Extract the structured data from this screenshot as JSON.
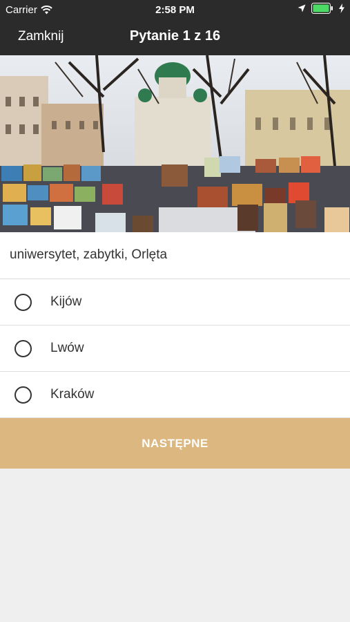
{
  "status_bar": {
    "carrier": "Carrier",
    "time": "2:58 PM",
    "icons": [
      "wifi-icon",
      "location-icon",
      "battery-icon",
      "charging-icon"
    ]
  },
  "nav": {
    "close_label": "Zamknij",
    "title": "Pytanie 1 z 16"
  },
  "question": {
    "hint": "uniwersytet, zabytki, Orlęta"
  },
  "options": [
    {
      "label": "Kijów",
      "selected": false
    },
    {
      "label": "Lwów",
      "selected": false
    },
    {
      "label": "Kraków",
      "selected": false
    }
  ],
  "next_button": {
    "label": "NASTĘPNE"
  },
  "colors": {
    "bar_background": "#2b2b2b",
    "accent": "#dcb77f",
    "battery": "#4cd964"
  }
}
